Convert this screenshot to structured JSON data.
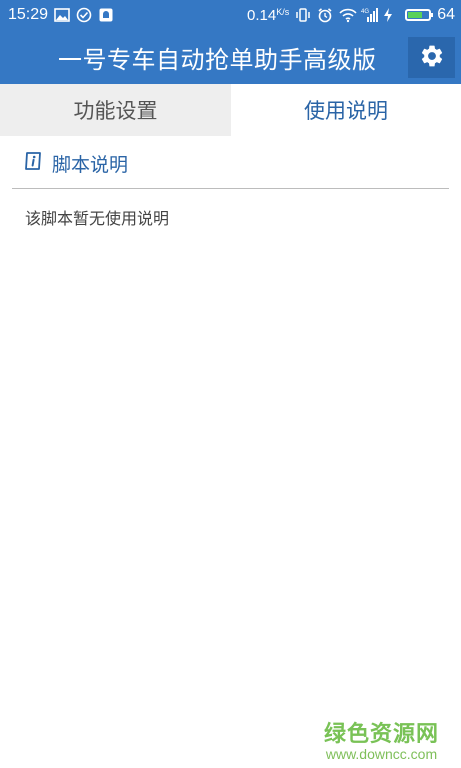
{
  "status_bar": {
    "time": "15:29",
    "speed": "0.14",
    "speed_unit": "K/s",
    "battery_level": "64",
    "icons": [
      "image-icon",
      "check-circle-icon",
      "notification-icon",
      "vibrate-icon",
      "alarm-icon",
      "wifi-icon",
      "signal-4g-icon",
      "charging-icon",
      "battery-icon"
    ]
  },
  "header": {
    "title": "一号专车自动抢单助手高级版",
    "settings_icon": "gear-icon"
  },
  "tabs": [
    {
      "label": "功能设置",
      "active": false
    },
    {
      "label": "使用说明",
      "active": true
    }
  ],
  "section": {
    "title": "脚本说明",
    "icon": "info-icon",
    "body": "该脚本暂无使用说明"
  },
  "watermark": {
    "line1": "绿色资源网",
    "line2": "www.downcc.com"
  },
  "colors": {
    "header_bg": "#3578c4",
    "accent_text": "#2a64a6",
    "inactive_tab_bg": "#eeeeee"
  }
}
